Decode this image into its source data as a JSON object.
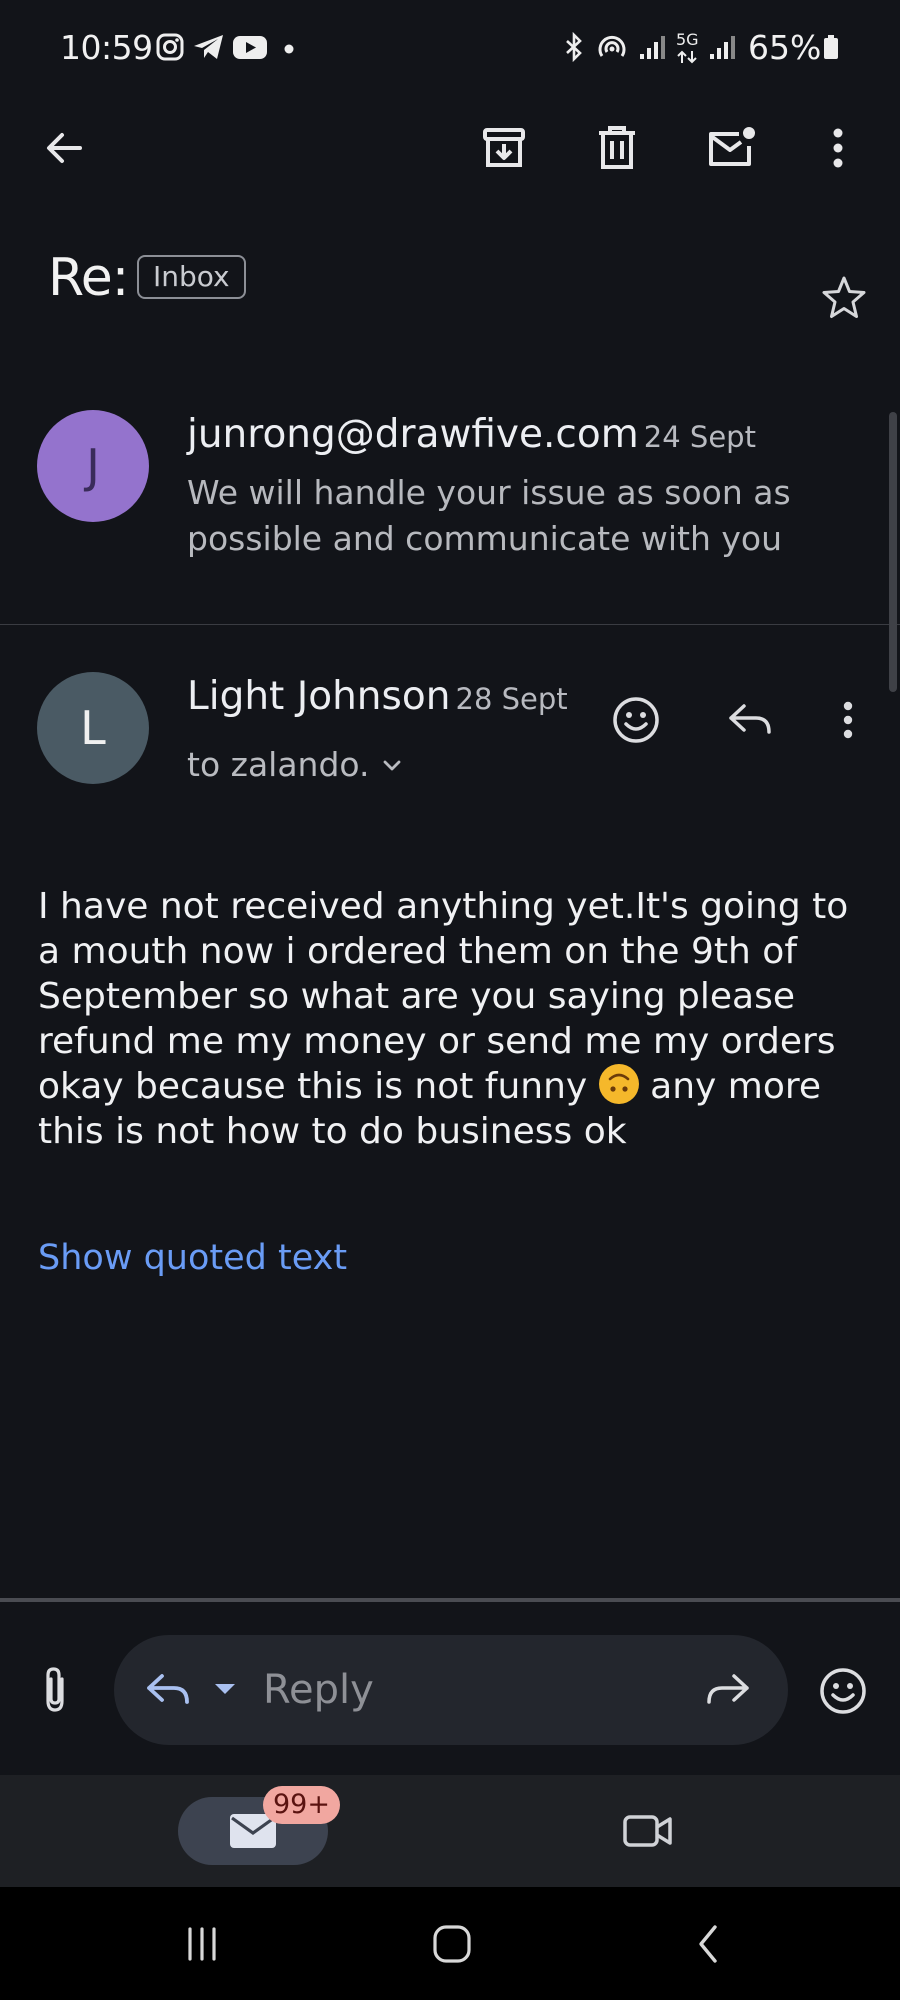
{
  "status_bar": {
    "time": "10:59",
    "network": "5G",
    "battery": "65%"
  },
  "toolbar": {
    "back_icon": "arrow-left-icon",
    "archive_icon": "archive-icon",
    "delete_icon": "trash-icon",
    "mark_unread_icon": "mail-unread-icon",
    "more_icon": "more-vert-icon"
  },
  "thread": {
    "subject": "Re:",
    "label": "Inbox"
  },
  "messages": [
    {
      "avatar_letter": "J",
      "avatar_color": "#9473cd",
      "sender": "junrong@drawfive.com",
      "date": "24 Sept",
      "snippet": "We will handle your issue as soon as possible and communicate with you"
    },
    {
      "avatar_letter": "L",
      "avatar_color": "#4a5a64",
      "sender": "Light Johnson",
      "date": "28 Sept",
      "recipients": "to zalando.",
      "body_part1": "I have not received anything yet.It's going to a mouth now i ordered them on the 9th of September so what are you saying please refund me my money or send me my orders okay because this is not funny",
      "body_part2": "any more this is not how to do business ok",
      "show_quoted": "Show quoted text"
    }
  ],
  "reply_bar": {
    "placeholder": "Reply"
  },
  "bottom_nav": {
    "mail_badge": "99+"
  },
  "colors": {
    "background": "#121419",
    "link": "#6a9cf5",
    "accent_badge": "#f1a7a0"
  }
}
